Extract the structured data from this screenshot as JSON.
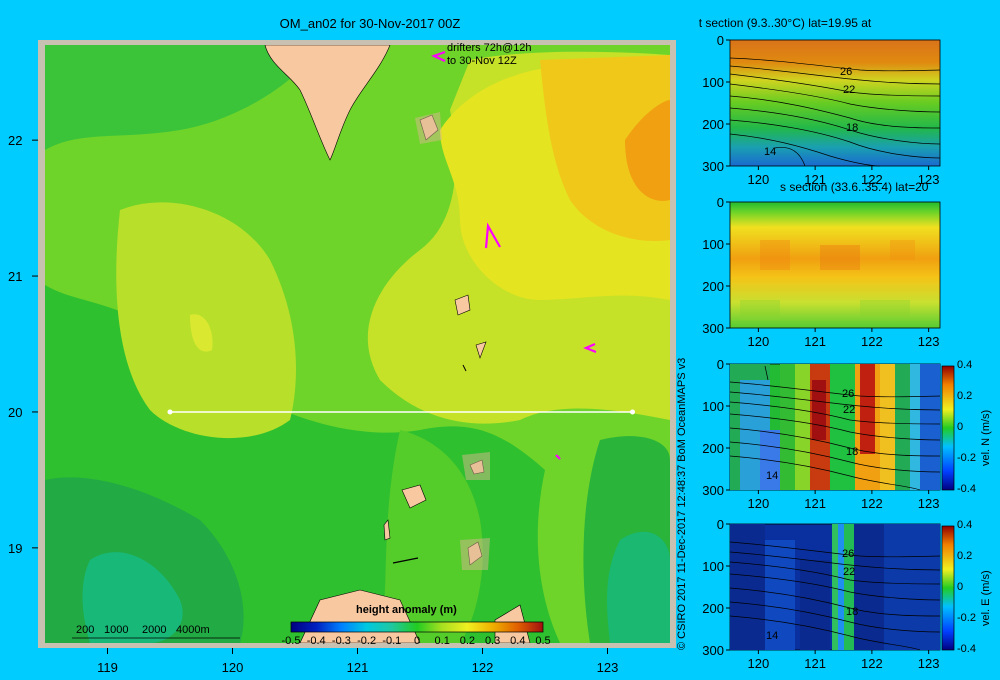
{
  "main_map": {
    "title": "OM_an02 for 30-Nov-2017 00Z",
    "drifter_note_line1": "drifters 72h@12h",
    "drifter_note_line2": "to 30-Nov 12Z",
    "depth_legend": [
      "200",
      "1000",
      "2000",
      "4000m"
    ],
    "colorbar_title": "height anomaly  (m)",
    "colorbar_ticks": [
      "-0.5",
      "-0.4",
      "-0.3",
      "-0.2",
      "-0.1",
      "0",
      "0.1",
      "0.2",
      "0.3",
      "0.4",
      "0.5"
    ],
    "x_ticks": [
      "119",
      "120",
      "121",
      "122",
      "123"
    ],
    "y_ticks": [
      "19",
      "20",
      "21",
      "22"
    ]
  },
  "side_label": "© CSIRO 2017   11-Dec-2017 12:48:37 BoM OceanMAPS v3",
  "sections": [
    {
      "title": "t section (9.3..30°C) lat=19.95 at",
      "contour_labels": [
        "26",
        "22",
        "18",
        "14"
      ],
      "colorbar_label": "",
      "colorbar_ticks": []
    },
    {
      "title": "s section (33.6..35.4) lat=20",
      "contour_labels": [],
      "colorbar_label": "",
      "colorbar_ticks": []
    },
    {
      "title": "",
      "contour_labels": [
        "26",
        "22",
        "18",
        "14"
      ],
      "colorbar_label": "vel. N (m/s)",
      "colorbar_ticks": [
        "0.4",
        "0.2",
        "0",
        "-0.2",
        "-0.4"
      ]
    },
    {
      "title": "",
      "contour_labels": [
        "26",
        "22",
        "18",
        "14"
      ],
      "colorbar_label": "vel. E (m/s)",
      "colorbar_ticks": [
        "0.4",
        "0.2",
        "0",
        "-0.2",
        "-0.4"
      ]
    }
  ],
  "section_axes": {
    "x_ticks": [
      "120",
      "121",
      "122",
      "123"
    ],
    "y_ticks": [
      "0",
      "100",
      "200",
      "300"
    ]
  },
  "chart_data": [
    {
      "type": "heatmap",
      "title": "OM_an02 for 30-Nov-2017 00Z",
      "variable": "height anomaly (m)",
      "xlim": [
        118.5,
        123.5
      ],
      "ylim": [
        18.3,
        22.7
      ],
      "x_ticks": [
        119,
        120,
        121,
        122,
        123
      ],
      "y_ticks": [
        19,
        20,
        21,
        22
      ],
      "color_range": [
        -0.5,
        0.5
      ],
      "section_line": {
        "lat": 20,
        "lon_start": 119.5,
        "lon_end": 123.2
      },
      "approx_field": [
        {
          "region": "west",
          "value": 0.0
        },
        {
          "region": "central-west plateau",
          "value": 0.1
        },
        {
          "region": "northeast",
          "value": 0.25
        },
        {
          "region": "far east",
          "value": 0.3
        },
        {
          "region": "south",
          "value": -0.05
        },
        {
          "region": "southwest",
          "value": -0.2
        }
      ]
    },
    {
      "type": "heatmap",
      "title": "t section (9.3..30°C) lat=19.95 at",
      "xlim": [
        119.5,
        123.2
      ],
      "ylim": [
        300,
        0
      ],
      "x_ticks": [
        120,
        121,
        122,
        123
      ],
      "y_ticks": [
        0,
        100,
        200,
        300
      ],
      "contour_levels": [
        26,
        22,
        18,
        14
      ]
    },
    {
      "type": "heatmap",
      "title": "s section (33.6..35.4) lat=20",
      "xlim": [
        119.5,
        123.2
      ],
      "ylim": [
        300,
        0
      ],
      "x_ticks": [
        120,
        121,
        122,
        123
      ],
      "y_ticks": [
        0,
        100,
        200,
        300
      ]
    },
    {
      "type": "heatmap",
      "variable": "vel. N (m/s)",
      "xlim": [
        119.5,
        123.2
      ],
      "ylim": [
        300,
        0
      ],
      "color_range": [
        -0.4,
        0.4
      ],
      "x_ticks": [
        120,
        121,
        122,
        123
      ],
      "y_ticks": [
        0,
        100,
        200,
        300
      ],
      "contour_levels": [
        26,
        22,
        18,
        14
      ]
    },
    {
      "type": "heatmap",
      "variable": "vel. E (m/s)",
      "xlim": [
        119.5,
        123.2
      ],
      "ylim": [
        300,
        0
      ],
      "color_range": [
        -0.4,
        0.4
      ],
      "x_ticks": [
        120,
        121,
        122,
        123
      ],
      "y_ticks": [
        0,
        100,
        200,
        300
      ],
      "contour_levels": [
        26,
        22,
        18,
        14
      ]
    }
  ]
}
